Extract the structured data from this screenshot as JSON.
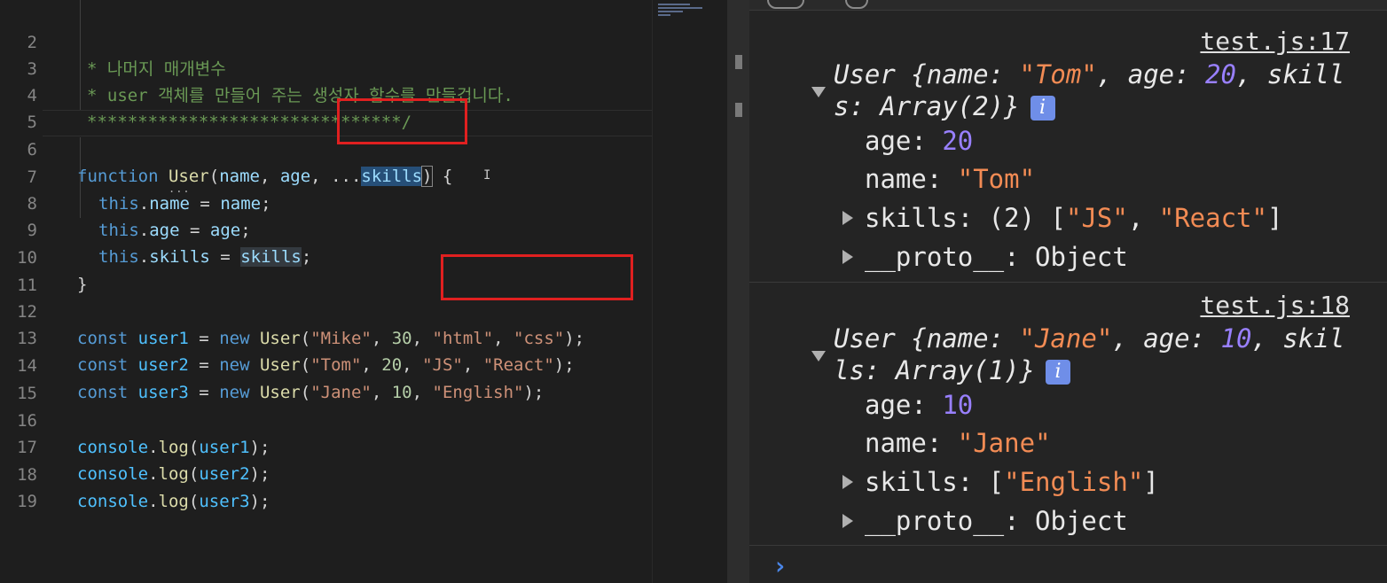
{
  "editor": {
    "line_numbers": [
      "2",
      "3",
      "4",
      "5",
      "6",
      "7",
      "8",
      "9",
      "10",
      "11",
      "12",
      "13",
      "14",
      "15",
      "16",
      "17",
      "18",
      "19"
    ],
    "comment1": "* 나머지 매개변수",
    "comment2": "* user 객체를 만들어 주는 생성자 함수를 만들겁니다.",
    "comment3": "*******************************/",
    "l6": {
      "kw": "function",
      "fn": "User",
      "p1": "(",
      "a1": "name",
      "c1": ", ",
      "a2": "age",
      "c2": ", ",
      "spread": "...",
      "a3": "skills",
      "p2": ")",
      "b": " {"
    },
    "l7": {
      "this": "this",
      "dot": ".",
      "prop": "name",
      "eq": " = ",
      "val": "name",
      "semi": ";"
    },
    "l8": {
      "this": "this",
      "dot": ".",
      "prop": "age",
      "eq": " = ",
      "val": "age",
      "semi": ";"
    },
    "l9": {
      "this": "this",
      "dot": ".",
      "prop": "skills",
      "eq": " = ",
      "val": "skills",
      "semi": ";"
    },
    "l10": "}",
    "l12": {
      "kw": "const",
      "var": "user1",
      "eq": " = ",
      "new": "new",
      "fn": "User",
      "open": "(",
      "s1": "\"Mike\"",
      "c1": ", ",
      "n": "30",
      "c2": ", ",
      "s2": "\"html\"",
      "c3": ", ",
      "s3": "\"css\"",
      "close": ");"
    },
    "l13": {
      "kw": "const",
      "var": "user2",
      "eq": " = ",
      "new": "new",
      "fn": "User",
      "open": "(",
      "s1": "\"Tom\"",
      "c1": ", ",
      "n": "20",
      "c2": ", ",
      "s2": "\"JS\"",
      "c3": ", ",
      "s3": "\"React\"",
      "close": ");"
    },
    "l14": {
      "kw": "const",
      "var": "user3",
      "eq": " = ",
      "new": "new",
      "fn": "User",
      "open": "(",
      "s1": "\"Jane\"",
      "c1": ", ",
      "n": "10",
      "c2": ", ",
      "s2": "\"English\"",
      "close": ");"
    },
    "l16": {
      "obj": "console",
      "dot": ".",
      "fn": "log",
      "open": "(",
      "arg": "user1",
      "close": ");"
    },
    "l17": {
      "obj": "console",
      "dot": ".",
      "fn": "log",
      "open": "(",
      "arg": "user2",
      "close": ");"
    },
    "l18": {
      "obj": "console",
      "dot": ".",
      "fn": "log",
      "open": "(",
      "arg": "user3",
      "close": ");"
    },
    "cursor_glyph": "I"
  },
  "console": {
    "entry1": {
      "source": "test.js:17",
      "sum_a": "User {name: ",
      "sum_name": "\"Tom\"",
      "sum_b": ", age: ",
      "sum_age": "20",
      "sum_c": ", skill",
      "sum_d": "s: Array(2)}",
      "info": "i",
      "age_key": "age: ",
      "age_val": "20",
      "name_key": "name: ",
      "name_val": "\"Tom\"",
      "skills_a": "skills: (2) [",
      "skills_v1": "\"JS\"",
      "skills_sep": ", ",
      "skills_v2": "\"React\"",
      "skills_end": "]",
      "proto": "__proto__: Object"
    },
    "entry2": {
      "source": "test.js:18",
      "sum_a": "User {name: ",
      "sum_name": "\"Jane\"",
      "sum_b": ", age: ",
      "sum_age": "10",
      "sum_c": ", skil",
      "sum_d": "ls: Array(1)}",
      "info": "i",
      "age_key": "age: ",
      "age_val": "10",
      "name_key": "name: ",
      "name_val": "\"Jane\"",
      "skills_a": "skills: [",
      "skills_v1": "\"English\"",
      "skills_end": "]",
      "proto": "__proto__: Object"
    },
    "prompt": "›"
  },
  "colors": {
    "comment": "#6a9955",
    "keyword": "#569cd6",
    "function": "#dcdcaa",
    "variable": "#9cdcfe",
    "string": "#ce9178",
    "number": "#b5cea8",
    "console_string": "#f28b54",
    "console_number": "#9980ff",
    "highlight_box": "#e02020"
  }
}
